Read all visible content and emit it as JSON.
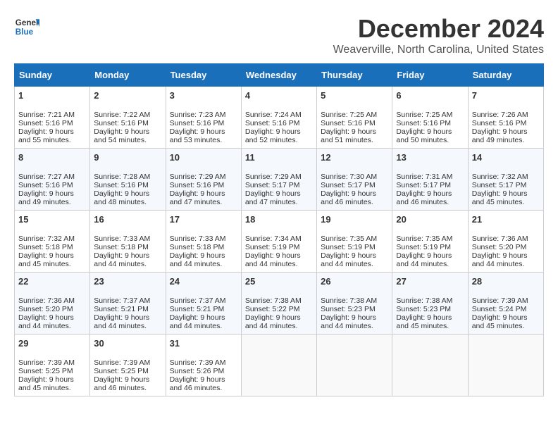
{
  "header": {
    "logo_general": "General",
    "logo_blue": "Blue",
    "month": "December 2024",
    "location": "Weaverville, North Carolina, United States"
  },
  "days_of_week": [
    "Sunday",
    "Monday",
    "Tuesday",
    "Wednesday",
    "Thursday",
    "Friday",
    "Saturday"
  ],
  "weeks": [
    [
      {
        "day": "1",
        "sunrise": "Sunrise: 7:21 AM",
        "sunset": "Sunset: 5:16 PM",
        "daylight": "Daylight: 9 hours and 55 minutes."
      },
      {
        "day": "2",
        "sunrise": "Sunrise: 7:22 AM",
        "sunset": "Sunset: 5:16 PM",
        "daylight": "Daylight: 9 hours and 54 minutes."
      },
      {
        "day": "3",
        "sunrise": "Sunrise: 7:23 AM",
        "sunset": "Sunset: 5:16 PM",
        "daylight": "Daylight: 9 hours and 53 minutes."
      },
      {
        "day": "4",
        "sunrise": "Sunrise: 7:24 AM",
        "sunset": "Sunset: 5:16 PM",
        "daylight": "Daylight: 9 hours and 52 minutes."
      },
      {
        "day": "5",
        "sunrise": "Sunrise: 7:25 AM",
        "sunset": "Sunset: 5:16 PM",
        "daylight": "Daylight: 9 hours and 51 minutes."
      },
      {
        "day": "6",
        "sunrise": "Sunrise: 7:25 AM",
        "sunset": "Sunset: 5:16 PM",
        "daylight": "Daylight: 9 hours and 50 minutes."
      },
      {
        "day": "7",
        "sunrise": "Sunrise: 7:26 AM",
        "sunset": "Sunset: 5:16 PM",
        "daylight": "Daylight: 9 hours and 49 minutes."
      }
    ],
    [
      {
        "day": "8",
        "sunrise": "Sunrise: 7:27 AM",
        "sunset": "Sunset: 5:16 PM",
        "daylight": "Daylight: 9 hours and 49 minutes."
      },
      {
        "day": "9",
        "sunrise": "Sunrise: 7:28 AM",
        "sunset": "Sunset: 5:16 PM",
        "daylight": "Daylight: 9 hours and 48 minutes."
      },
      {
        "day": "10",
        "sunrise": "Sunrise: 7:29 AM",
        "sunset": "Sunset: 5:16 PM",
        "daylight": "Daylight: 9 hours and 47 minutes."
      },
      {
        "day": "11",
        "sunrise": "Sunrise: 7:29 AM",
        "sunset": "Sunset: 5:17 PM",
        "daylight": "Daylight: 9 hours and 47 minutes."
      },
      {
        "day": "12",
        "sunrise": "Sunrise: 7:30 AM",
        "sunset": "Sunset: 5:17 PM",
        "daylight": "Daylight: 9 hours and 46 minutes."
      },
      {
        "day": "13",
        "sunrise": "Sunrise: 7:31 AM",
        "sunset": "Sunset: 5:17 PM",
        "daylight": "Daylight: 9 hours and 46 minutes."
      },
      {
        "day": "14",
        "sunrise": "Sunrise: 7:32 AM",
        "sunset": "Sunset: 5:17 PM",
        "daylight": "Daylight: 9 hours and 45 minutes."
      }
    ],
    [
      {
        "day": "15",
        "sunrise": "Sunrise: 7:32 AM",
        "sunset": "Sunset: 5:18 PM",
        "daylight": "Daylight: 9 hours and 45 minutes."
      },
      {
        "day": "16",
        "sunrise": "Sunrise: 7:33 AM",
        "sunset": "Sunset: 5:18 PM",
        "daylight": "Daylight: 9 hours and 44 minutes."
      },
      {
        "day": "17",
        "sunrise": "Sunrise: 7:33 AM",
        "sunset": "Sunset: 5:18 PM",
        "daylight": "Daylight: 9 hours and 44 minutes."
      },
      {
        "day": "18",
        "sunrise": "Sunrise: 7:34 AM",
        "sunset": "Sunset: 5:19 PM",
        "daylight": "Daylight: 9 hours and 44 minutes."
      },
      {
        "day": "19",
        "sunrise": "Sunrise: 7:35 AM",
        "sunset": "Sunset: 5:19 PM",
        "daylight": "Daylight: 9 hours and 44 minutes."
      },
      {
        "day": "20",
        "sunrise": "Sunrise: 7:35 AM",
        "sunset": "Sunset: 5:19 PM",
        "daylight": "Daylight: 9 hours and 44 minutes."
      },
      {
        "day": "21",
        "sunrise": "Sunrise: 7:36 AM",
        "sunset": "Sunset: 5:20 PM",
        "daylight": "Daylight: 9 hours and 44 minutes."
      }
    ],
    [
      {
        "day": "22",
        "sunrise": "Sunrise: 7:36 AM",
        "sunset": "Sunset: 5:20 PM",
        "daylight": "Daylight: 9 hours and 44 minutes."
      },
      {
        "day": "23",
        "sunrise": "Sunrise: 7:37 AM",
        "sunset": "Sunset: 5:21 PM",
        "daylight": "Daylight: 9 hours and 44 minutes."
      },
      {
        "day": "24",
        "sunrise": "Sunrise: 7:37 AM",
        "sunset": "Sunset: 5:21 PM",
        "daylight": "Daylight: 9 hours and 44 minutes."
      },
      {
        "day": "25",
        "sunrise": "Sunrise: 7:38 AM",
        "sunset": "Sunset: 5:22 PM",
        "daylight": "Daylight: 9 hours and 44 minutes."
      },
      {
        "day": "26",
        "sunrise": "Sunrise: 7:38 AM",
        "sunset": "Sunset: 5:23 PM",
        "daylight": "Daylight: 9 hours and 44 minutes."
      },
      {
        "day": "27",
        "sunrise": "Sunrise: 7:38 AM",
        "sunset": "Sunset: 5:23 PM",
        "daylight": "Daylight: 9 hours and 45 minutes."
      },
      {
        "day": "28",
        "sunrise": "Sunrise: 7:39 AM",
        "sunset": "Sunset: 5:24 PM",
        "daylight": "Daylight: 9 hours and 45 minutes."
      }
    ],
    [
      {
        "day": "29",
        "sunrise": "Sunrise: 7:39 AM",
        "sunset": "Sunset: 5:25 PM",
        "daylight": "Daylight: 9 hours and 45 minutes."
      },
      {
        "day": "30",
        "sunrise": "Sunrise: 7:39 AM",
        "sunset": "Sunset: 5:25 PM",
        "daylight": "Daylight: 9 hours and 46 minutes."
      },
      {
        "day": "31",
        "sunrise": "Sunrise: 7:39 AM",
        "sunset": "Sunset: 5:26 PM",
        "daylight": "Daylight: 9 hours and 46 minutes."
      },
      null,
      null,
      null,
      null
    ]
  ]
}
